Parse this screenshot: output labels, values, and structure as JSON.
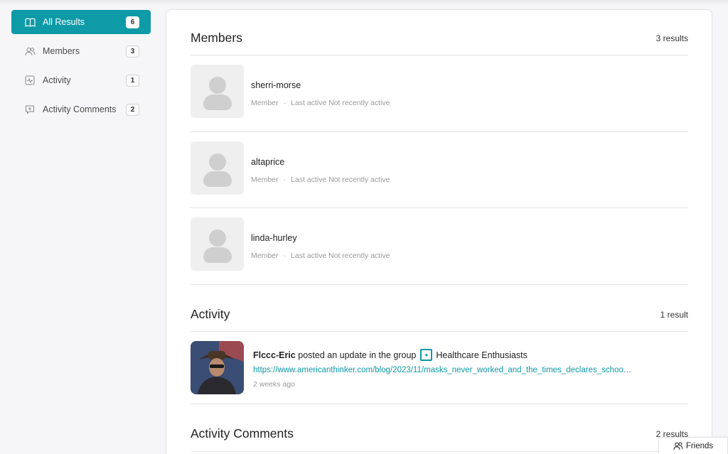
{
  "sidebar": {
    "items": [
      {
        "label": "All Results",
        "count": "6",
        "icon": "book-icon",
        "active": true
      },
      {
        "label": "Members",
        "count": "3",
        "icon": "users-icon",
        "active": false
      },
      {
        "label": "Activity",
        "count": "1",
        "icon": "activity-icon",
        "active": false
      },
      {
        "label": "Activity Comments",
        "count": "2",
        "icon": "comment-icon",
        "active": false
      }
    ]
  },
  "members": {
    "title": "Members",
    "count": "3 results",
    "items": [
      {
        "name": "sherri-morse",
        "role": "Member",
        "separator": "·",
        "last_active": "Last active Not recently active"
      },
      {
        "name": "altaprice",
        "role": "Member",
        "separator": "·",
        "last_active": "Last active Not recently active"
      },
      {
        "name": "linda-hurley",
        "role": "Member",
        "separator": "·",
        "last_active": "Last active Not recently active"
      }
    ]
  },
  "activity": {
    "title": "Activity",
    "count": "1 result",
    "item": {
      "author": "Flccc-Eric",
      "action": "posted an update in the group",
      "group": "Healthcare Enthusiasts",
      "link": "https://www.americanthinker.com/blog/2023/11/masks_never_worked_and_the_times_declares_schoo…",
      "time": "2 weeks ago"
    }
  },
  "activity_comments": {
    "title": "Activity Comments",
    "count": "2 results"
  },
  "friends_button": {
    "label": "Friends"
  },
  "colors": {
    "accent": "#0e9aa7"
  }
}
